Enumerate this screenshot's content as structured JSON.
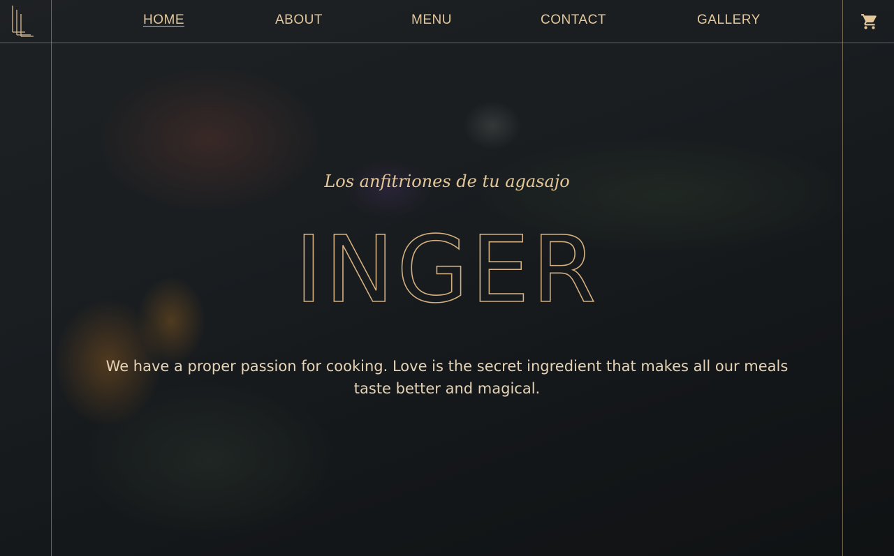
{
  "nav": {
    "items": [
      {
        "label": "HOME",
        "active": true
      },
      {
        "label": "ABOUT",
        "active": false
      },
      {
        "label": "MENU",
        "active": false
      },
      {
        "label": "CONTACT",
        "active": false
      },
      {
        "label": "GALLERY",
        "active": false
      }
    ],
    "cart_icon": "cart-icon"
  },
  "hero": {
    "tagline": "Los anfitriones de tu agasajo",
    "brand": "INGER",
    "description": "We have a proper passion for cooking. Love is the secret ingredient that makes all our meals taste better and magical."
  },
  "colors": {
    "accent": "#e3c79a",
    "line": "#bea578",
    "background": "#1a1d1f"
  }
}
